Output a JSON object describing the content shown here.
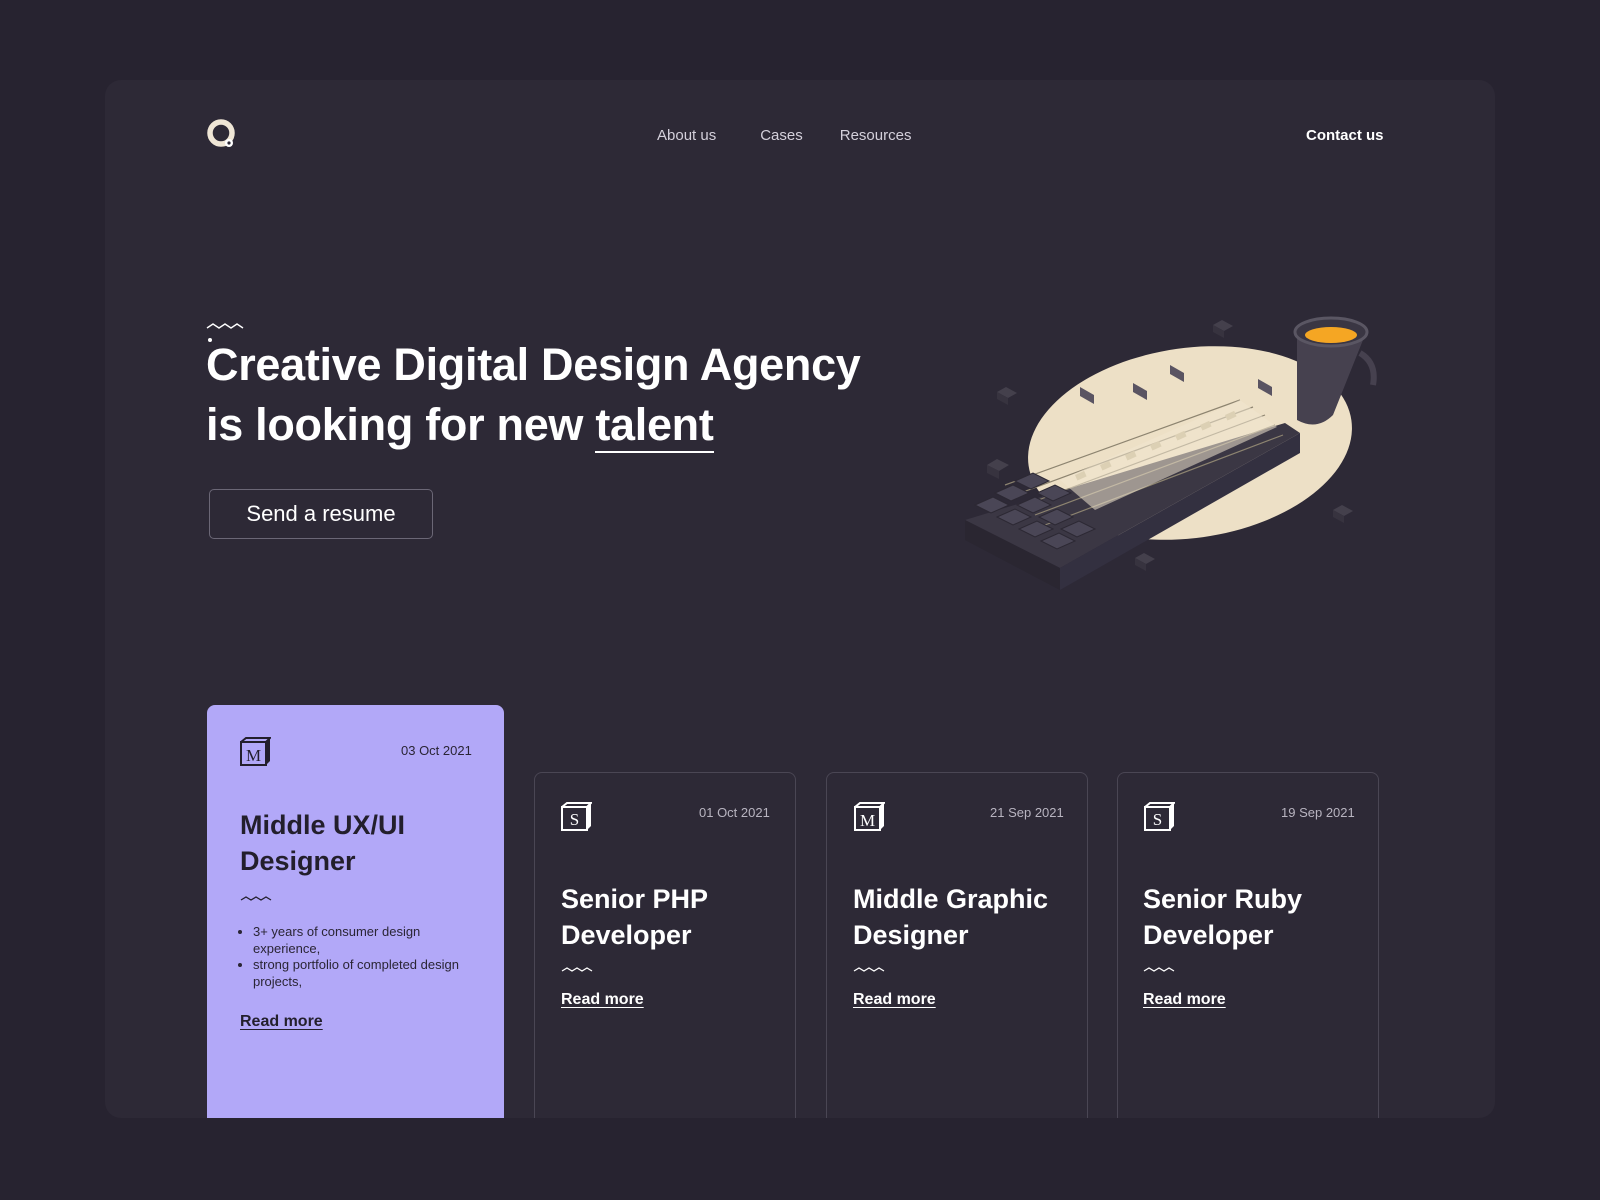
{
  "brand": {
    "logo_icon": "q-logo-icon",
    "accent": "#f5a623"
  },
  "nav": {
    "items": [
      {
        "label": "About us"
      },
      {
        "label": "Cases"
      },
      {
        "label": "Resources"
      }
    ],
    "contact_label": "Contact us"
  },
  "hero": {
    "title_line1": "Creative Digital Design Agency",
    "title_line2_prefix": "is looking for new ",
    "title_line2_emphasis": "talent",
    "cta_label": "Send a resume",
    "illustration_icon": "keyboard-coffee-illustration"
  },
  "cards": [
    {
      "icon": "medium-icon",
      "date": "03 Oct 2021",
      "title_line1": "Middle UX/UI",
      "title_line2": "Designer",
      "bullets": [
        "3+ years of consumer design experience,",
        "strong portfolio of completed design projects,"
      ],
      "read_more": "Read more",
      "color": "#b2a8f8"
    },
    {
      "icon": "stackoverflow-s-icon",
      "date": "01 Oct 2021",
      "title_line1": "Senior PHP",
      "title_line2": "Developer",
      "read_more": "Read more"
    },
    {
      "icon": "medium-icon",
      "date": "21 Sep 2021",
      "title_line1": "Middle Graphic",
      "title_line2": "Designer",
      "read_more": "Read more"
    },
    {
      "icon": "stackoverflow-s-icon",
      "date": "19 Sep 2021",
      "title_line1": "Senior Ruby",
      "title_line2": "Developer",
      "read_more": "Read more"
    }
  ]
}
